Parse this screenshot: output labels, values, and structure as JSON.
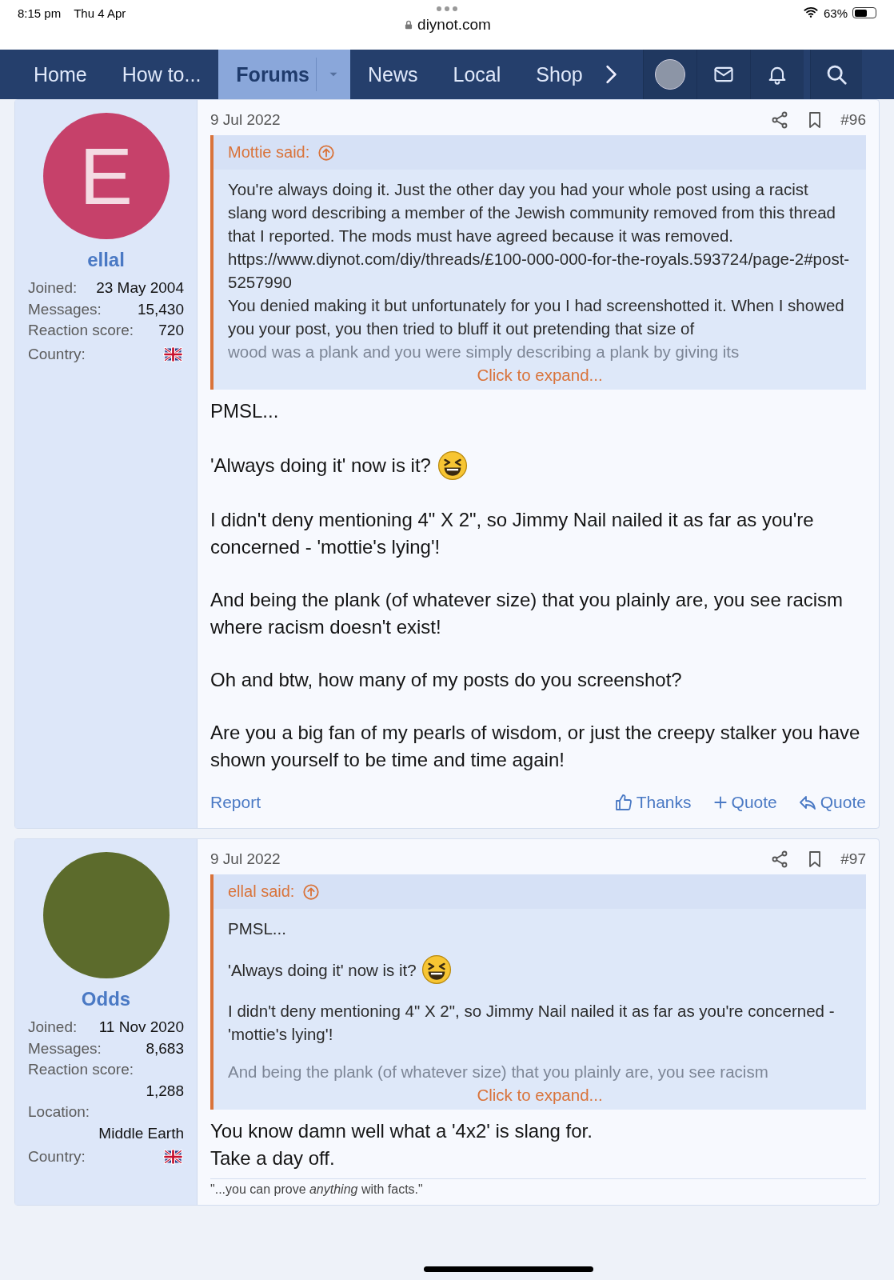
{
  "status_bar": {
    "time": "8:15 pm",
    "date": "Thu 4 Apr",
    "url": "diynot.com",
    "battery": "63%"
  },
  "nav": {
    "items": [
      {
        "label": "Home",
        "selected": false,
        "dropdown": false
      },
      {
        "label": "How to...",
        "selected": false,
        "dropdown": false
      },
      {
        "label": "Forums",
        "selected": true,
        "dropdown": true
      },
      {
        "label": "News",
        "selected": false,
        "dropdown": false
      },
      {
        "label": "Local",
        "selected": false,
        "dropdown": false
      },
      {
        "label": "Shop",
        "selected": false,
        "dropdown": false
      }
    ]
  },
  "posts": [
    {
      "user": {
        "avatar": {
          "kind": "initial",
          "initial": "E"
        },
        "name": "ellal",
        "stats": [
          {
            "label": "Joined:",
            "value": "23 May 2004",
            "kind": "inline"
          },
          {
            "label": "Messages:",
            "value": "15,430",
            "kind": "inline"
          },
          {
            "label": "Reaction score:",
            "value": "720",
            "kind": "inline"
          },
          {
            "label": "Country:",
            "kind": "flag"
          }
        ]
      },
      "date": "9 Jul 2022",
      "number": "#96",
      "quote": {
        "author": "Mottie said:",
        "paragraphs": [
          {
            "text": "You're always doing it. Just the other day you had your whole post using a racist slang word describing a member of the Jewish community removed from this thread that I reported. The mods must have agreed because it was removed. https://www.diynot.com/diy/threads/£100-000-000-for-the-royals.593724/page-2#post-5257990",
            "emoji": false
          },
          {
            "text": "You denied making it but unfortunately for you I had screenshotted it. When I showed you your post, you then tried to bluff it out pretending that size of",
            "emoji": false
          }
        ],
        "faded": "wood was a plank and you were simply describing a plank by giving its",
        "expand": "Click to expand..."
      },
      "body": [
        {
          "text": "PMSL...",
          "emoji": false
        },
        {
          "text": "'Always doing it' now is it?",
          "emoji": true
        },
        {
          "text": "I didn't deny mentioning 4\" X 2\", so Jimmy Nail nailed it as far as you're concerned - 'mottie's lying'!",
          "emoji": false
        },
        {
          "text": "And being the plank (of whatever size) that you plainly are, you see racism where racism doesn't exist!",
          "emoji": false
        },
        {
          "text": "Oh and btw, how many of my posts do you screenshot?",
          "emoji": false
        },
        {
          "text": "Are you a big fan of my pearls of wisdom, or just the creepy stalker you have shown yourself to be time and time again!",
          "emoji": false
        }
      ],
      "actions": {
        "report": "Report",
        "thanks": "Thanks",
        "multiquote": "Quote",
        "quote": "Quote"
      }
    },
    {
      "user": {
        "avatar": {
          "kind": "photo"
        },
        "name": "Odds",
        "stats": [
          {
            "label": "Joined:",
            "value": "11 Nov 2020",
            "kind": "inline"
          },
          {
            "label": "Messages:",
            "value": "8,683",
            "kind": "inline"
          },
          {
            "label": "Reaction score:",
            "value": "1,288",
            "kind": "stacked"
          },
          {
            "label": "Location:",
            "value": "Middle Earth",
            "kind": "stacked"
          },
          {
            "label": "Country:",
            "kind": "flag"
          }
        ]
      },
      "date": "9 Jul 2022",
      "number": "#97",
      "quote": {
        "author": "ellal said:",
        "paragraphs": [
          {
            "text": "PMSL...",
            "emoji": false
          },
          {
            "text": "'Always doing it' now is it?",
            "emoji": true
          },
          {
            "text": "I didn't deny mentioning 4\" X 2\", so Jimmy Nail nailed it as far as you're concerned - 'mottie's lying'!",
            "emoji": false
          }
        ],
        "faded": "And being the plank (of whatever size) that you plainly are, you see racism",
        "expand": "Click to expand..."
      },
      "body": [
        {
          "text": "You know damn well what a '4x2' is slang for.\nTake a day off.",
          "emoji": false
        }
      ],
      "signature": "\"...you can prove *anything* with facts.\""
    }
  ]
}
